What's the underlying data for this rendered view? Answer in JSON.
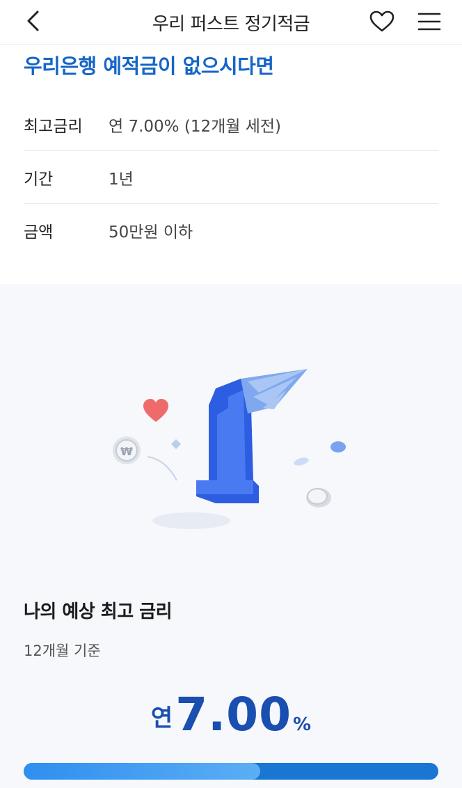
{
  "header": {
    "title": "우리 퍼스트 정기적금",
    "back_icon": "chevron-left-icon",
    "favorite_icon": "heart-outline-icon",
    "menu_icon": "hamburger-menu-icon"
  },
  "headline": "우리은행 예적금이 없으시다면",
  "info": [
    {
      "label": "최고금리",
      "value": "연 7.00% (12개월 세전)"
    },
    {
      "label": "기간",
      "value": "1년"
    },
    {
      "label": "금액",
      "value": "50만원 이하"
    }
  ],
  "expected": {
    "title": "나의 예상 최고 금리",
    "subtitle": "12개월 기준",
    "rate_prefix": "연",
    "rate_value": "7.00",
    "rate_unit": "%",
    "progress_fraction": 0.57
  },
  "colors": {
    "accent": "#1565c8",
    "rate": "#1a4fb0",
    "progress_track": "#1976d2",
    "progress_fill": "#3a98f2"
  }
}
